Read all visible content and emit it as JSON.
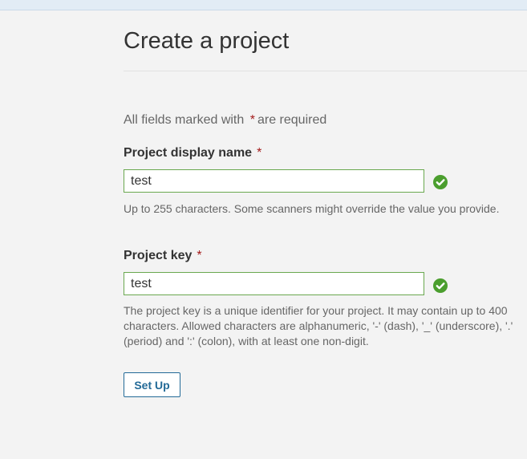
{
  "page": {
    "title": "Create a project"
  },
  "form": {
    "required_note_prefix": "All fields marked with",
    "required_marker": "*",
    "required_note_suffix": "are required",
    "display_name": {
      "label": "Project display name",
      "value": "test",
      "help": "Up to 255 characters. Some scanners might override the value you provide.",
      "status_icon": "check-circle-icon"
    },
    "project_key": {
      "label": "Project key",
      "value": "test",
      "help": "The project key is a unique identifier for your project. It may contain up to 400 characters. Allowed characters are alphanumeric, '-' (dash), '_' (underscore), '.' (period) and ':' (colon), with at least one non-digit.",
      "status_icon": "check-circle-icon"
    },
    "submit_label": "Set Up"
  },
  "colors": {
    "background": "#f3f3f3",
    "valid_green": "#4b9e2e",
    "required_red": "#a31a1a",
    "button_blue": "#236a97"
  }
}
